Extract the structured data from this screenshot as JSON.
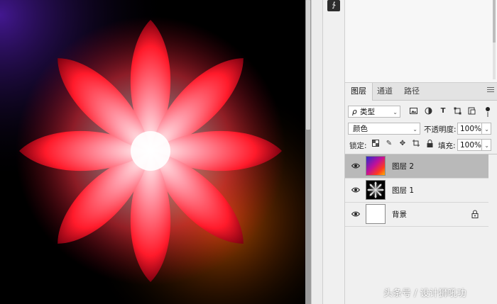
{
  "history_tool": {
    "icon": "history-brush-icon",
    "glyph": "∱"
  },
  "layers_panel": {
    "tabs": [
      {
        "label": "图层",
        "active": true
      },
      {
        "label": "通道",
        "active": false
      },
      {
        "label": "路径",
        "active": false
      }
    ],
    "filter": {
      "value": "类型",
      "search_glyph": "ρ"
    },
    "blend_mode": {
      "value": "颜色"
    },
    "opacity": {
      "label": "不透明度:",
      "value": "100%"
    },
    "lock": {
      "label": "锁定:"
    },
    "fill": {
      "label": "填充:",
      "value": "100%"
    },
    "layers": [
      {
        "name": "图层 2",
        "selected": true,
        "visible": true
      },
      {
        "name": "图层 1",
        "selected": false,
        "visible": true
      },
      {
        "name": "背景",
        "selected": false,
        "visible": true,
        "locked": true
      }
    ]
  },
  "watermark": {
    "text": "头条号 / 设计狮吼功"
  },
  "colors": {
    "canvas_bg": "#000000",
    "flower_core": "#ffffff",
    "flower_mid": "#ff3344",
    "panel_bg": "#f0f0f0",
    "selected_layer": "#b9b9b9"
  }
}
